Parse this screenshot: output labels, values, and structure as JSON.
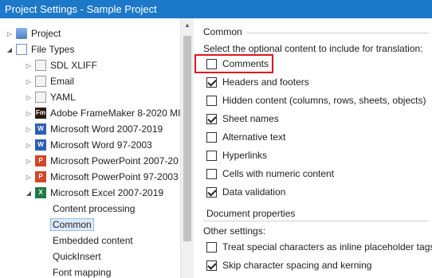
{
  "window": {
    "title": "Project Settings - Sample Project"
  },
  "tree": {
    "items": [
      {
        "label": "Project",
        "icon": "project-icon",
        "toggle": "▷"
      },
      {
        "label": "File Types",
        "icon": "file-types-icon",
        "toggle": "◢"
      },
      {
        "label": "SDL XLIFF",
        "icon": "document-icon",
        "toggle": "▷"
      },
      {
        "label": "Email",
        "icon": "email-icon",
        "toggle": "▷"
      },
      {
        "label": "YAML",
        "icon": "document-icon",
        "toggle": "▷"
      },
      {
        "label": "Adobe FrameMaker 8-2020 MI",
        "icon": "framemaker-icon",
        "toggle": "▷",
        "badge": "Fm"
      },
      {
        "label": "Microsoft Word 2007-2019",
        "icon": "word-icon",
        "toggle": "▷",
        "badge": "W"
      },
      {
        "label": "Microsoft Word 97-2003",
        "icon": "word-icon",
        "toggle": "▷",
        "badge": "W"
      },
      {
        "label": "Microsoft PowerPoint 2007-20",
        "icon": "powerpoint-icon",
        "toggle": "▷",
        "badge": "P"
      },
      {
        "label": "Microsoft PowerPoint 97-2003",
        "icon": "powerpoint-icon",
        "toggle": "▷",
        "badge": "P"
      },
      {
        "label": "Microsoft Excel 2007-2019",
        "icon": "excel-icon",
        "toggle": "◢",
        "badge": "X"
      },
      {
        "label": "Content processing"
      },
      {
        "label": "Common",
        "selected": true
      },
      {
        "label": "Embedded content"
      },
      {
        "label": "QuickInsert"
      },
      {
        "label": "Font mapping"
      }
    ]
  },
  "panel": {
    "common_title": "Common",
    "instruction": "Select the optional content to include for translation:",
    "options": [
      {
        "label": "Comments",
        "checked": false,
        "highlighted": true
      },
      {
        "label": "Headers and footers",
        "checked": true
      },
      {
        "label": "Hidden content (columns, rows, sheets, objects)",
        "checked": false
      },
      {
        "label": "Sheet names",
        "checked": true
      },
      {
        "label": "Alternative text",
        "checked": false
      },
      {
        "label": "Hyperlinks",
        "checked": false
      },
      {
        "label": "Cells with numeric content",
        "checked": false
      },
      {
        "label": "Data validation",
        "checked": true
      }
    ],
    "document_properties_label": "Document properties",
    "other_settings_title": "Other settings:",
    "other_options": [
      {
        "label": "Treat special characters as inline placeholder tags",
        "checked": false
      },
      {
        "label": "Skip character spacing and kerning",
        "checked": true
      }
    ]
  },
  "colors": {
    "titlebar": "#1c78c8",
    "highlight": "#e0141e"
  }
}
